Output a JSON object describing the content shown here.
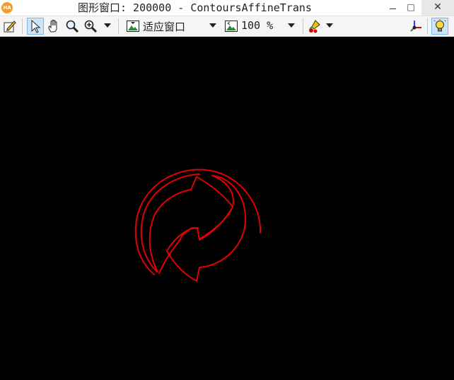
{
  "window": {
    "title": "图形窗口: 200000 - ContoursAffineTrans",
    "app_badge": "HA",
    "maximize_glyph": "□",
    "close_glyph": "✕"
  },
  "toolbar": {
    "fit_label": "适应窗口",
    "zoom_label": "100 %",
    "tools": [
      "draw-tool-icon",
      "pointer-icon",
      "pan-hand-icon",
      "magnifier-icon",
      "zoom-in-icon",
      "fit-window-icon",
      "zoom-percent-icon",
      "color-picker-icon",
      "axes-icon",
      "lightbulb-icon"
    ]
  },
  "canvas": {
    "background": "#000000",
    "contour_color": "#e00000"
  }
}
